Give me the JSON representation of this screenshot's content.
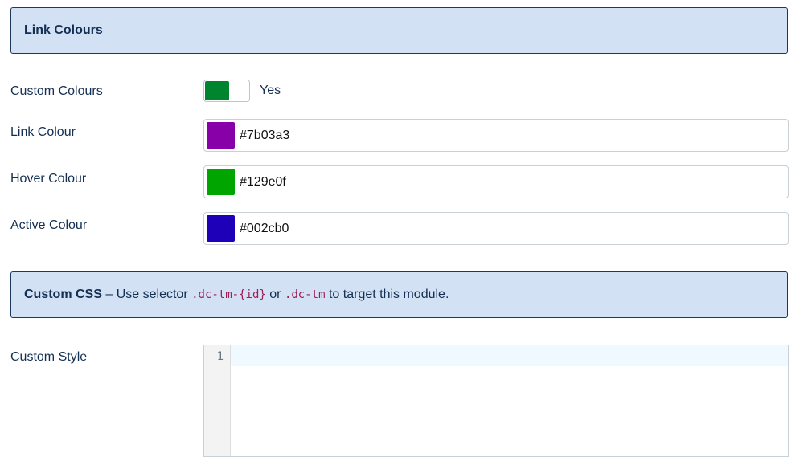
{
  "link_section": {
    "title": "Link Colours",
    "custom_colours": {
      "label": "Custom Colours",
      "toggle_value": "Yes",
      "toggle_on": true,
      "toggle_color": "#00852e"
    },
    "fields": [
      {
        "label": "Link Colour",
        "value": "#7b03a3",
        "swatch": "#8800a8"
      },
      {
        "label": "Hover Colour",
        "value": "#129e0f",
        "swatch": "#00a500"
      },
      {
        "label": "Active Colour",
        "value": "#002cb0",
        "swatch": "#1e00b8"
      }
    ]
  },
  "css_section": {
    "title": "Custom CSS",
    "dash": "–",
    "text_before": "Use selector",
    "selector_1": ".dc-tm-{id}",
    "text_or": "or",
    "selector_2": ".dc-tm",
    "text_after": "to target this module.",
    "custom_style": {
      "label": "Custom Style",
      "line_number": "1",
      "value": ""
    }
  }
}
